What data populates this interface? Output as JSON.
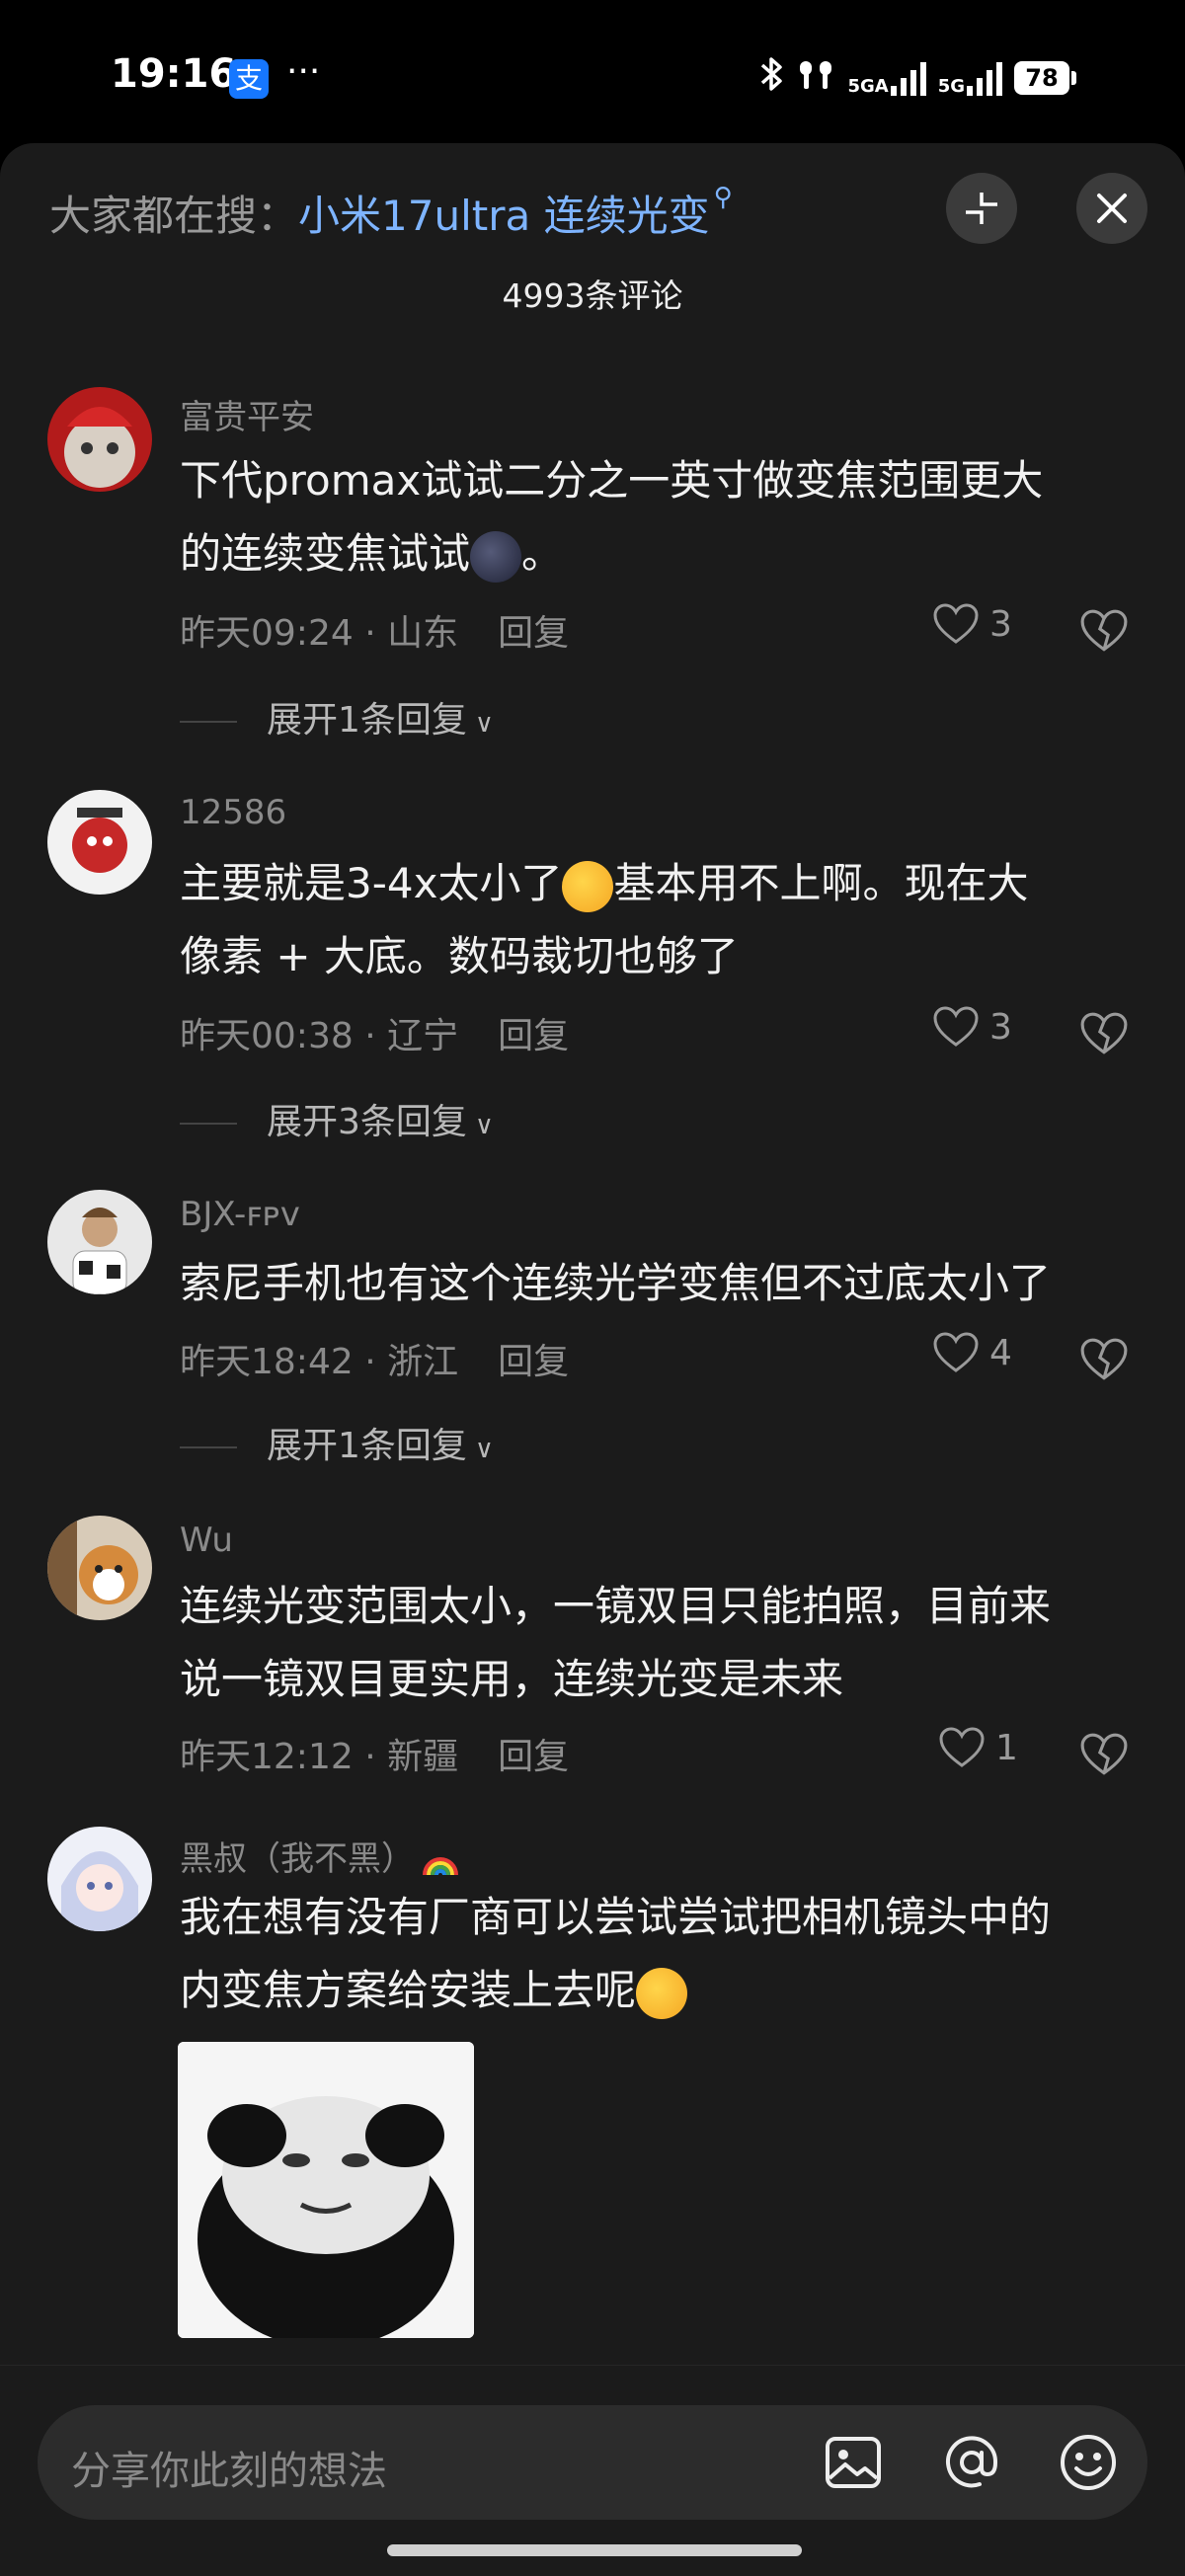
{
  "status_bar": {
    "time": "19:16",
    "app_badge": "支",
    "dots": "···",
    "network_1": "5GA",
    "network_2": "5G",
    "battery": "78"
  },
  "header": {
    "search_prefix": "大家都在搜：",
    "search_term": "小米17ultra 连续光变",
    "comment_count": "4993条评论"
  },
  "comments": [
    {
      "username": "富贵平安",
      "text_line1": "下代promax试试二分之一英寸做变焦范围更大",
      "text_line2": "的连续变焦试试",
      "text_line2_tail": "。",
      "time": "昨天09:24",
      "location": "山东",
      "reply": "回复",
      "likes": "3",
      "expand": "展开1条回复"
    },
    {
      "username": "12586",
      "text_line1_a": "主要就是3-4x太小了",
      "text_line1_b": "基本用不上啊。现在大",
      "text_line2": "像素 + 大底。数码裁切也够了",
      "time": "昨天00:38",
      "location": "辽宁",
      "reply": "回复",
      "likes": "3",
      "expand": "展开3条回复"
    },
    {
      "username": "BJX-ꜰᴘᴠ",
      "text_line1": "索尼手机也有这个连续光学变焦但不过底太小了",
      "time": "昨天18:42",
      "location": "浙江",
      "reply": "回复",
      "likes": "4",
      "expand": "展开1条回复"
    },
    {
      "username": "Wu",
      "text_line1": "连续光变范围太小，一镜双目只能拍照，目前来",
      "text_line2": "说一镜双目更实用，连续光变是未来",
      "time": "昨天12:12",
      "location": "新疆",
      "reply": "回复",
      "likes": "1"
    },
    {
      "username": "黑叔（我不黑）",
      "text_line1": "我在想有没有厂商可以尝试尝试把相机镜头中的",
      "text_line2": "内变焦方案给安装上去呢"
    }
  ],
  "composer": {
    "placeholder": "分享你此刻的想法"
  },
  "icons": {
    "fullscreen": "collapse-icon",
    "close": "close-icon",
    "like": "heart-icon",
    "dislike": "broken-heart-icon",
    "image": "image-icon",
    "mention": "at-icon",
    "emoji": "smiley-icon"
  },
  "colors": {
    "background": "#1b1b1b",
    "search_term": "#7eb4ff",
    "muted": "#8a8a8a"
  }
}
